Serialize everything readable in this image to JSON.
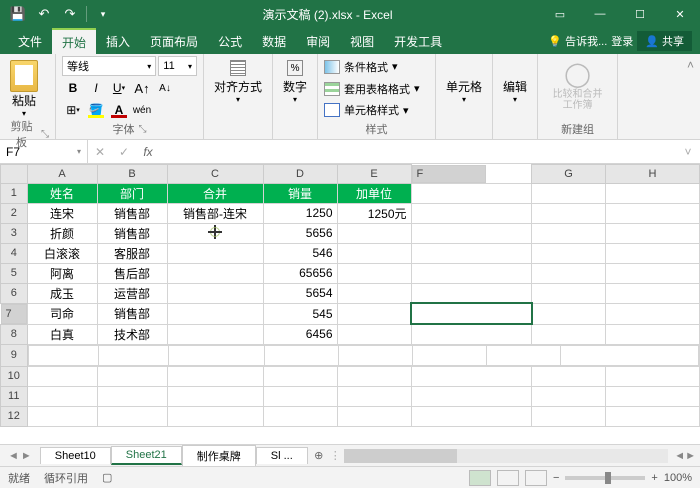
{
  "title": "演示文稿 (2).xlsx - Excel",
  "menu": {
    "file": "文件",
    "home": "开始",
    "insert": "插入",
    "layout": "页面布局",
    "formula": "公式",
    "data": "数据",
    "review": "审阅",
    "view": "视图",
    "dev": "开发工具",
    "tell": "告诉我...",
    "login": "登录",
    "share": "共享"
  },
  "ribbon": {
    "paste": "粘贴",
    "clipboard": "剪贴板",
    "font_name": "等线",
    "font_size": "11",
    "font_label": "字体",
    "align": "对齐方式",
    "number": "数字",
    "cond_fmt": "条件格式",
    "table_fmt": "套用表格格式",
    "cell_fmt": "单元格样式",
    "styles": "样式",
    "cells": "单元格",
    "edit": "编辑",
    "compare": "比较和合并工作簿",
    "newgroup": "新建组"
  },
  "namebox": "F7",
  "chart_data": {
    "type": "table",
    "columns": [
      "",
      "A",
      "B",
      "C",
      "D",
      "E",
      "F",
      "G",
      "H"
    ],
    "headers": {
      "A": "姓名",
      "B": "部门",
      "C": "合并",
      "D": "销量",
      "E": "加单位"
    },
    "rows": [
      {
        "n": 2,
        "A": "连宋",
        "B": "销售部",
        "C": "销售部-连宋",
        "D": 1250,
        "E": "1250元"
      },
      {
        "n": 3,
        "A": "折颜",
        "B": "销售部",
        "C": "",
        "D": 5656,
        "E": ""
      },
      {
        "n": 4,
        "A": "白滚滚",
        "B": "客服部",
        "C": "",
        "D": 546,
        "E": ""
      },
      {
        "n": 5,
        "A": "阿离",
        "B": "售后部",
        "C": "",
        "D": 65656,
        "E": ""
      },
      {
        "n": 6,
        "A": "成玉",
        "B": "运营部",
        "C": "",
        "D": 5654,
        "E": ""
      },
      {
        "n": 7,
        "A": "司命",
        "B": "销售部",
        "C": "",
        "D": 545,
        "E": ""
      },
      {
        "n": 8,
        "A": "白真",
        "B": "技术部",
        "C": "",
        "D": 6456,
        "E": ""
      }
    ]
  },
  "sheets": {
    "s1": "Sheet10",
    "s2": "Sheet21",
    "s3": "制作桌牌",
    "s4": "Sl"
  },
  "status": {
    "ready": "就绪",
    "circ": "循环引用",
    "zoom": "100%"
  }
}
